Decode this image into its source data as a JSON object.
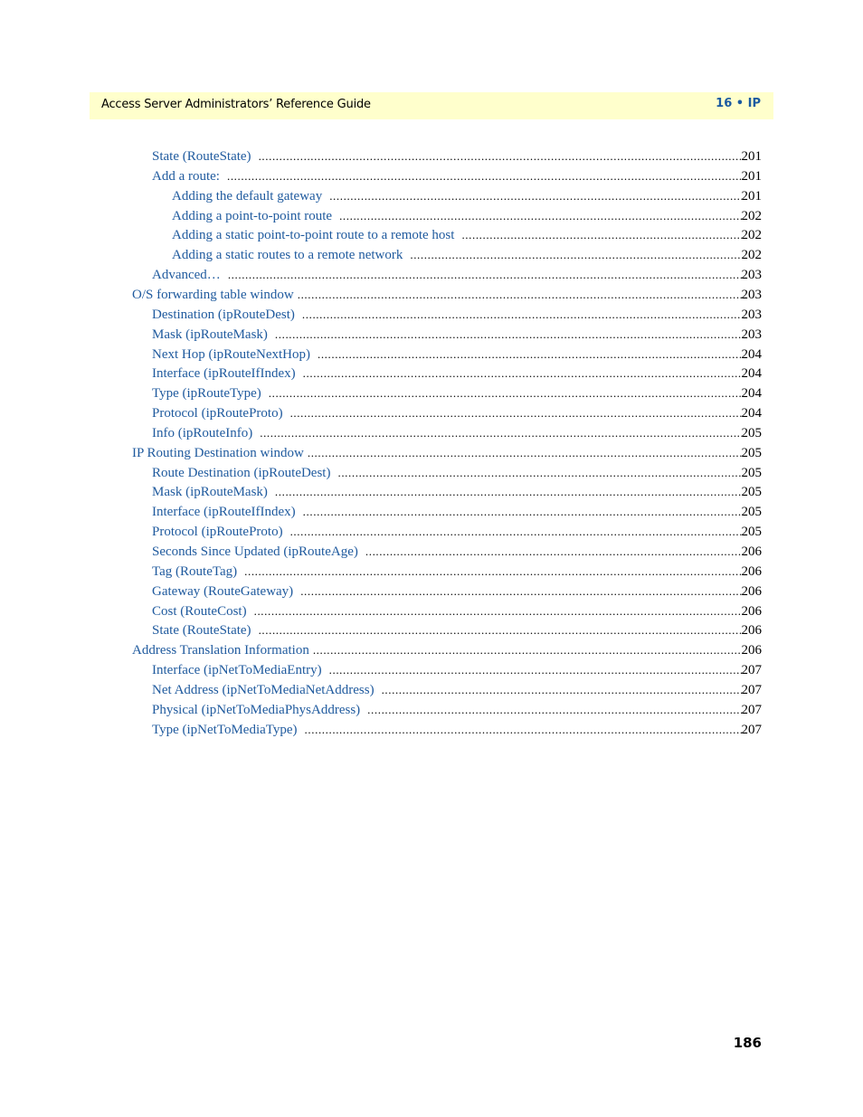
{
  "header": {
    "title": "Access Server Administrators’ Reference Guide",
    "section": "16 • IP"
  },
  "toc": [
    {
      "level": 2,
      "label": "State (RouteState)",
      "page": "201"
    },
    {
      "level": 2,
      "label": "Add a route:",
      "page": "201"
    },
    {
      "level": 3,
      "label": "Adding the default gateway",
      "page": "201"
    },
    {
      "level": 3,
      "label": "Adding a point-to-point route",
      "page": "202"
    },
    {
      "level": 3,
      "label": "Adding a static point-to-point route to a remote host",
      "page": "202"
    },
    {
      "level": 3,
      "label": "Adding a static routes to a remote network",
      "page": "202"
    },
    {
      "level": 2,
      "label": "Advanced…",
      "page": "203"
    },
    {
      "level": 1,
      "label": "O/S forwarding table window",
      "page": "203"
    },
    {
      "level": 2,
      "label": "Destination (ipRouteDest)",
      "page": "203"
    },
    {
      "level": 2,
      "label": "Mask (ipRouteMask)",
      "page": "203"
    },
    {
      "level": 2,
      "label": "Next Hop (ipRouteNextHop)",
      "page": "204"
    },
    {
      "level": 2,
      "label": "Interface (ipRouteIfIndex)",
      "page": "204"
    },
    {
      "level": 2,
      "label": "Type (ipRouteType)",
      "page": "204"
    },
    {
      "level": 2,
      "label": "Protocol (ipRouteProto)",
      "page": "204"
    },
    {
      "level": 2,
      "label": "Info (ipRouteInfo)",
      "page": "205"
    },
    {
      "level": 1,
      "label": "IP Routing Destination window",
      "page": "205"
    },
    {
      "level": 2,
      "label": "Route Destination (ipRouteDest)",
      "page": "205"
    },
    {
      "level": 2,
      "label": "Mask (ipRouteMask)",
      "page": "205"
    },
    {
      "level": 2,
      "label": "Interface (ipRouteIfIndex)",
      "page": "205"
    },
    {
      "level": 2,
      "label": "Protocol (ipRouteProto)",
      "page": "205"
    },
    {
      "level": 2,
      "label": "Seconds Since Updated (ipRouteAge)",
      "page": "206"
    },
    {
      "level": 2,
      "label": "Tag (RouteTag)",
      "page": "206"
    },
    {
      "level": 2,
      "label": "Gateway (RouteGateway)",
      "page": "206"
    },
    {
      "level": 2,
      "label": "Cost (RouteCost)",
      "page": "206"
    },
    {
      "level": 2,
      "label": "State (RouteState)",
      "page": "206"
    },
    {
      "level": 1,
      "label": "Address Translation Information",
      "page": "206"
    },
    {
      "level": 2,
      "label": "Interface (ipNetToMediaEntry)",
      "page": "207"
    },
    {
      "level": 2,
      "label": "Net Address (ipNetToMediaNetAddress)",
      "page": "207"
    },
    {
      "level": 2,
      "label": "Physical (ipNetToMediaPhysAddress)",
      "page": "207"
    },
    {
      "level": 2,
      "label": "Type (ipNetToMediaType)",
      "page": "207"
    }
  ],
  "page_number": "186"
}
